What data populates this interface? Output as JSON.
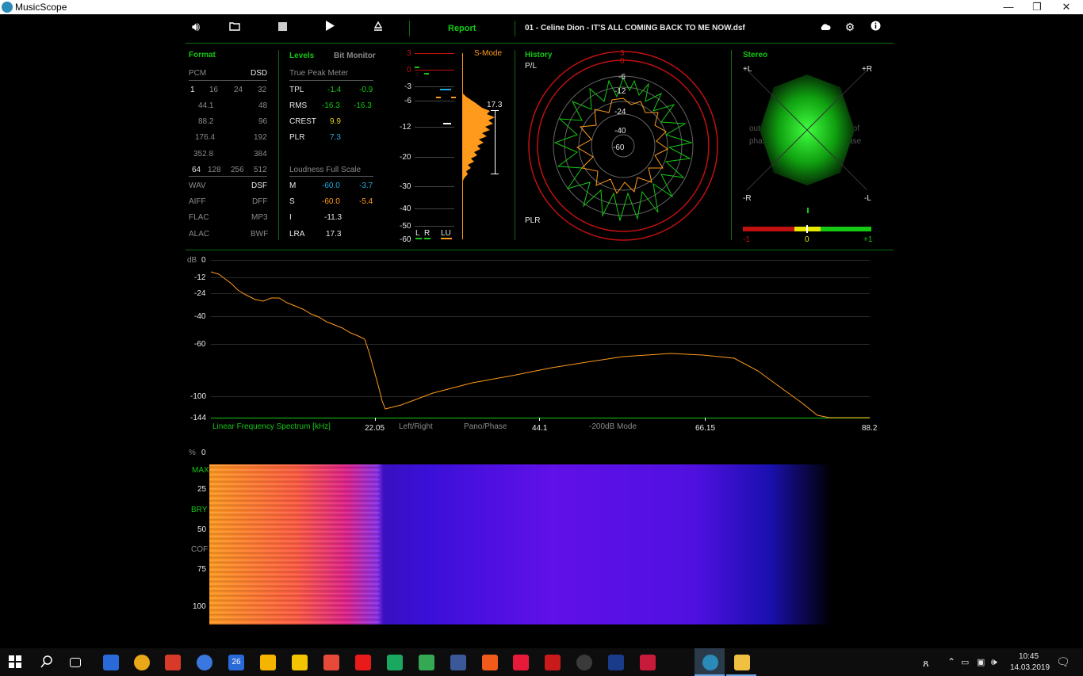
{
  "window": {
    "title": "MusicScope",
    "minimize": "—",
    "restore": "❐",
    "close": "✕"
  },
  "toolbar": {
    "speaker_icon": "speaker-icon",
    "folder_icon": "folder-icon",
    "stop_icon": "stop-icon",
    "play_icon": "play-icon",
    "eject_icon": "eject-icon",
    "report_label": "Report",
    "track_title": "01 - Celine Dion - IT'S ALL COMING BACK TO ME NOW.dsf",
    "cloud_icon": "cloud-icon",
    "settings_icon": "gear-icon",
    "info_icon": "info-icon"
  },
  "format": {
    "header": "Format",
    "pcm": "PCM",
    "dsd": "DSD",
    "bits": [
      "1",
      "16",
      "24",
      "32"
    ],
    "rates_left": [
      "44.1",
      "88.2",
      "176.4",
      "352.8"
    ],
    "rates_right": [
      "48",
      "96",
      "192",
      "384"
    ],
    "dsd_rates": [
      "64",
      "128",
      "256",
      "512"
    ],
    "files_left": [
      "WAV",
      "AIFF",
      "FLAC",
      "ALAC"
    ],
    "files_right": [
      "DSF",
      "DFF",
      "MP3",
      "BWF"
    ]
  },
  "levels": {
    "header": "Levels",
    "bit_monitor": "Bit Monitor",
    "tpm_title": "True Peak Meter",
    "rows": [
      {
        "label": "TPL",
        "l": "-1.4",
        "r": "-0.9"
      },
      {
        "label": "RMS",
        "l": "-16.3",
        "r": "-16.3"
      },
      {
        "label": "CREST",
        "l": "9.9",
        "r": ""
      },
      {
        "label": "PLR",
        "l": "7.3",
        "r": ""
      }
    ],
    "lfs_title": "Loudness Full Scale",
    "lfs_rows": [
      {
        "label": "M",
        "a": "-60.0",
        "b": "-3.7"
      },
      {
        "label": "S",
        "a": "-60.0",
        "b": "-5.4"
      },
      {
        "label": "I",
        "a": "-11.3",
        "b": ""
      },
      {
        "label": "LRA",
        "a": "17.3",
        "b": ""
      }
    ]
  },
  "meter": {
    "ticks": [
      "3",
      "0",
      "-3",
      "-6",
      "-12",
      "-20",
      "-30",
      "-40",
      "-50",
      "-60"
    ],
    "s_mode": "S-Mode",
    "lra_value": "17.3",
    "l": "L",
    "r": "R",
    "lu": "LU"
  },
  "history": {
    "header": "History",
    "pl": "P/L",
    "plr": "PLR",
    "rings": [
      "3",
      "0",
      "-6",
      "-12",
      "-24",
      "-40",
      "-60"
    ]
  },
  "stereo": {
    "header": "Stereo",
    "plus_l": "+L",
    "plus_r": "+R",
    "minus_r": "-R",
    "minus_l": "-L",
    "out_of_phase_left": "out of\nphase",
    "out_of_phase_right": "out of\nphase",
    "corr_min": "-1",
    "corr_mid": "0",
    "corr_max": "+1"
  },
  "spectrum": {
    "db_label": "dB",
    "y_ticks": [
      "0",
      "-12",
      "-24",
      "-40",
      "-60",
      "-100",
      "-144"
    ],
    "x_title": "Linear Frequency Spectrum [kHz]",
    "x_ticks": [
      "22.05",
      "44.1",
      "66.15",
      "88.2"
    ],
    "mode_buttons": [
      "Left/Right",
      "Pano/Phase",
      "-200dB Mode"
    ]
  },
  "spectrogram": {
    "pct": "%",
    "y_ticks": [
      "0",
      "25",
      "50",
      "75",
      "100"
    ],
    "max_label": "MAX",
    "bry_label": "BRY",
    "cof_label": "COF"
  },
  "taskbar": {
    "time": "10:45",
    "date": "14.03.2019",
    "calendar_day": "26"
  },
  "colors": {
    "accent_green": "#14c814",
    "orange": "#ff9a1c",
    "cyan": "#22aadd",
    "red": "#c01010"
  }
}
